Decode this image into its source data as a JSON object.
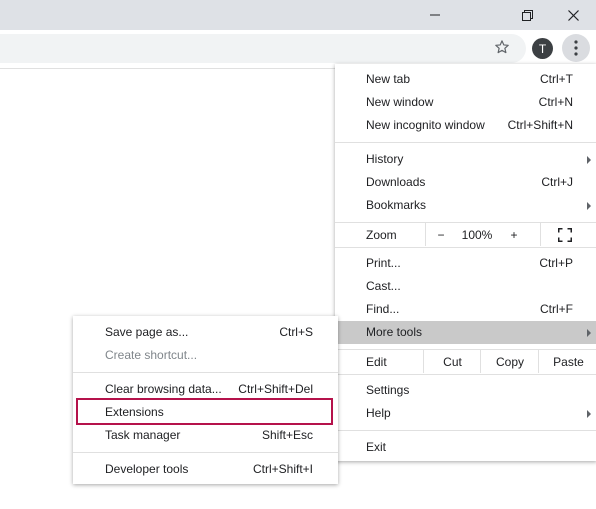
{
  "window": {
    "minimize_icon": "minimize-icon",
    "restore_icon": "restore-icon",
    "close_icon": "close-icon"
  },
  "toolbar": {
    "star_icon": "star-icon",
    "avatar_letter": "T",
    "menu_icon": "kebab-menu-icon"
  },
  "main_menu": {
    "new_tab": {
      "label": "New tab",
      "shortcut": "Ctrl+T"
    },
    "new_window": {
      "label": "New window",
      "shortcut": "Ctrl+N"
    },
    "new_incognito": {
      "label": "New incognito window",
      "shortcut": "Ctrl+Shift+N"
    },
    "history": {
      "label": "History"
    },
    "downloads": {
      "label": "Downloads",
      "shortcut": "Ctrl+J"
    },
    "bookmarks": {
      "label": "Bookmarks"
    },
    "zoom": {
      "label": "Zoom",
      "minus": "−",
      "value": "100%",
      "plus": "+"
    },
    "print": {
      "label": "Print...",
      "shortcut": "Ctrl+P"
    },
    "cast": {
      "label": "Cast..."
    },
    "find": {
      "label": "Find...",
      "shortcut": "Ctrl+F"
    },
    "more_tools": {
      "label": "More tools"
    },
    "edit": {
      "label": "Edit",
      "cut": "Cut",
      "copy": "Copy",
      "paste": "Paste"
    },
    "settings": {
      "label": "Settings"
    },
    "help": {
      "label": "Help"
    },
    "exit": {
      "label": "Exit"
    }
  },
  "sub_menu": {
    "save_page": {
      "label": "Save page as...",
      "shortcut": "Ctrl+S"
    },
    "create_shortcut": {
      "label": "Create shortcut..."
    },
    "clear_browsing": {
      "label": "Clear browsing data...",
      "shortcut": "Ctrl+Shift+Del"
    },
    "extensions": {
      "label": "Extensions"
    },
    "task_manager": {
      "label": "Task manager",
      "shortcut": "Shift+Esc"
    },
    "developer_tools": {
      "label": "Developer tools",
      "shortcut": "Ctrl+Shift+I"
    }
  },
  "colors": {
    "highlight_border": "#b5124b",
    "hover_row": "#c9c9c9",
    "titlebar": "#dee1e6"
  }
}
